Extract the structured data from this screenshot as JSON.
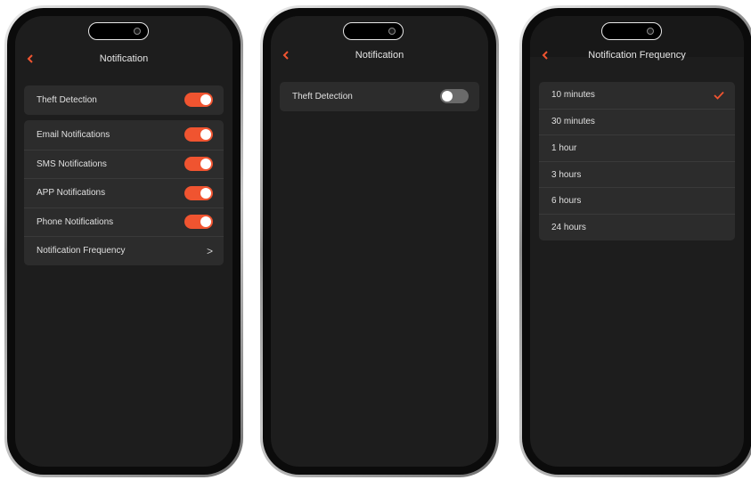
{
  "colors": {
    "accent": "#f05430",
    "background": "#1d1d1d",
    "card": "#2c2c2c"
  },
  "screen1": {
    "title": "Notification",
    "theft": {
      "label": "Theft Detection",
      "on": true
    },
    "items": [
      {
        "label": "Email Notifications",
        "on": true
      },
      {
        "label": "SMS Notifications",
        "on": true
      },
      {
        "label": "APP Notifications",
        "on": true
      },
      {
        "label": "Phone Notifications",
        "on": true
      }
    ],
    "frequency_label": "Notification Frequency",
    "frequency_chevron": ">"
  },
  "screen2": {
    "title": "Notification",
    "theft": {
      "label": "Theft Detection",
      "on": false
    }
  },
  "screen3": {
    "title": "Notification Frequency",
    "selected_index": 0,
    "options": [
      {
        "label": "10 minutes"
      },
      {
        "label": "30 minutes"
      },
      {
        "label": "1 hour"
      },
      {
        "label": "3 hours"
      },
      {
        "label": "6 hours"
      },
      {
        "label": "24 hours"
      }
    ]
  }
}
